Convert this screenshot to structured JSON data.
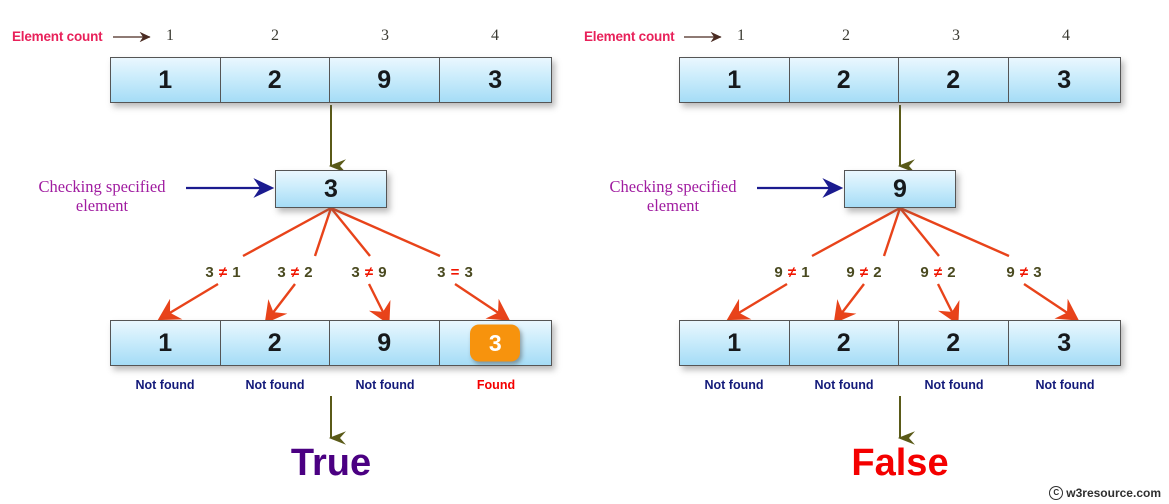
{
  "watermark": {
    "symbol": "C",
    "text": "w3resource.com"
  },
  "panels": [
    {
      "id": "left",
      "element_count_label": "Element count",
      "counts": [
        "1",
        "2",
        "3",
        "4"
      ],
      "top_array": [
        "1",
        "2",
        "9",
        "3"
      ],
      "checking_label_line1": "Checking specified",
      "checking_label_line2": "element",
      "search_value": "3",
      "comparisons": [
        {
          "left": "3",
          "op": "≠",
          "right": "1"
        },
        {
          "left": "3",
          "op": "≠",
          "right": "2"
        },
        {
          "left": "3",
          "op": "≠",
          "right": "9"
        },
        {
          "left": "3",
          "op": "=",
          "right": "3"
        }
      ],
      "bottom_array": [
        "1",
        "2",
        "9",
        "3"
      ],
      "highlight_index": 3,
      "results": [
        "Not found",
        "Not found",
        "Not found",
        "Found"
      ],
      "found_index": 3,
      "verdict": "True"
    },
    {
      "id": "right",
      "element_count_label": "Element count",
      "counts": [
        "1",
        "2",
        "3",
        "4"
      ],
      "top_array": [
        "1",
        "2",
        "2",
        "3"
      ],
      "checking_label_line1": "Checking specified",
      "checking_label_line2": "element",
      "search_value": "9",
      "comparisons": [
        {
          "left": "9",
          "op": "≠",
          "right": "1"
        },
        {
          "left": "9",
          "op": "≠",
          "right": "2"
        },
        {
          "left": "9",
          "op": "≠",
          "right": "2"
        },
        {
          "left": "9",
          "op": "≠",
          "right": "3"
        }
      ],
      "bottom_array": [
        "1",
        "2",
        "2",
        "3"
      ],
      "highlight_index": -1,
      "results": [
        "Not found",
        "Not found",
        "Not found",
        "Not found"
      ],
      "found_index": -1,
      "verdict": "False"
    }
  ],
  "colors": {
    "count_label": "#e8215a",
    "checking_label": "#a01ca0",
    "fan_arrow": "#e8431a",
    "flow_arrow": "#5a5a18",
    "pointer_arrow": "#1b1b8f",
    "cell_fill_top": "#eaf7fe",
    "cell_fill_bottom": "#a5dcf6",
    "highlight": "#f7930d",
    "not_found": "#131a7a",
    "found": "#f40000",
    "true": "#4b0082",
    "false": "#f40000"
  }
}
